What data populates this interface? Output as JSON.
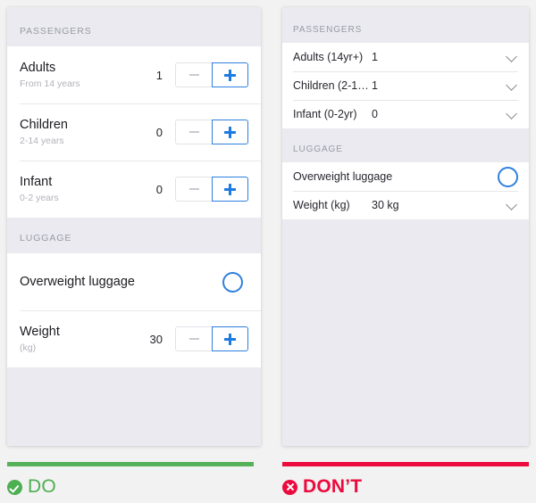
{
  "colors": {
    "accent_blue": "#1d7ae0",
    "do_green": "#4caf50",
    "dont_red": "#ec0a3e",
    "panel_bg": "#eaeaf0",
    "row_bg": "#ffffff"
  },
  "do_panel": {
    "sections": [
      {
        "header": "PASSENGERS",
        "rows": [
          {
            "title": "Adults",
            "subtitle": "From 14 years",
            "value": "1",
            "control": "stepper",
            "minus_icon": "minus-icon",
            "plus_icon": "plus-icon"
          },
          {
            "title": "Children",
            "subtitle": "2-14 years",
            "value": "0",
            "control": "stepper",
            "minus_icon": "minus-icon",
            "plus_icon": "plus-icon"
          },
          {
            "title": "Infant",
            "subtitle": "0-2 years",
            "value": "0",
            "control": "stepper",
            "minus_icon": "minus-icon",
            "plus_icon": "plus-icon"
          }
        ]
      },
      {
        "header": "LUGGAGE",
        "rows": [
          {
            "title": "Overweight luggage",
            "subtitle": "",
            "value": "",
            "control": "circle-toggle",
            "toggle_icon": "circle-toggle-icon"
          },
          {
            "title": "Weight",
            "subtitle": "(kg)",
            "value": "30",
            "control": "stepper",
            "minus_icon": "minus-icon",
            "plus_icon": "plus-icon"
          }
        ]
      }
    ]
  },
  "dont_panel": {
    "sections": [
      {
        "header": "PASSENGERS",
        "rows": [
          {
            "label": "Adults (14yr+)",
            "value": "1",
            "control": "chevron",
            "chevron_icon": "chevron-down-icon"
          },
          {
            "label": "Children (2-1…",
            "value": "1",
            "control": "chevron",
            "chevron_icon": "chevron-down-icon"
          },
          {
            "label": "Infant (0-2yr)",
            "value": "0",
            "control": "chevron",
            "chevron_icon": "chevron-down-icon"
          }
        ]
      },
      {
        "header": "LUGGAGE",
        "rows": [
          {
            "label": "Overweight luggage",
            "value": "",
            "control": "circle-toggle",
            "toggle_icon": "circle-toggle-icon"
          },
          {
            "label": "Weight (kg)",
            "value": "30 kg",
            "control": "chevron",
            "chevron_icon": "chevron-down-icon"
          }
        ]
      }
    ]
  },
  "footer": {
    "do": {
      "label": "DO",
      "icon": "check-circle-icon"
    },
    "dont": {
      "label": "DON’T",
      "icon": "x-circle-icon"
    }
  }
}
